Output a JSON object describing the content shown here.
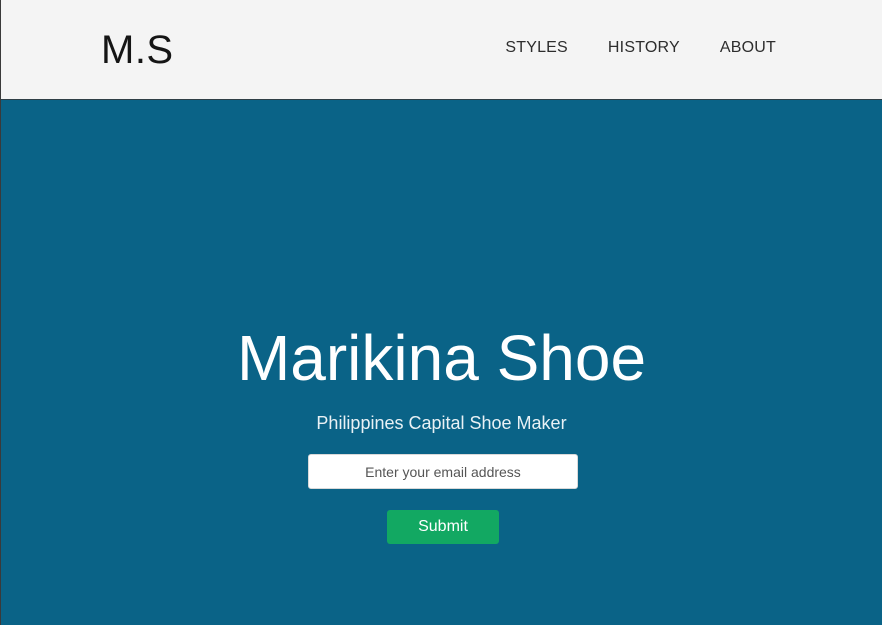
{
  "header": {
    "logo": "M.S",
    "nav": [
      {
        "label": "STYLES"
      },
      {
        "label": "HISTORY"
      },
      {
        "label": "ABOUT"
      }
    ]
  },
  "hero": {
    "title": "Marikina Shoe",
    "subtitle": "Philippines Capital Shoe Maker",
    "email_placeholder": "Enter your email address",
    "email_value": "",
    "submit_label": "Submit"
  },
  "colors": {
    "header_bg": "#f4f4f4",
    "hero_bg": "#0a6387",
    "button_bg": "#12a862",
    "text_light": "#ffffff",
    "text_dark": "#151515"
  }
}
